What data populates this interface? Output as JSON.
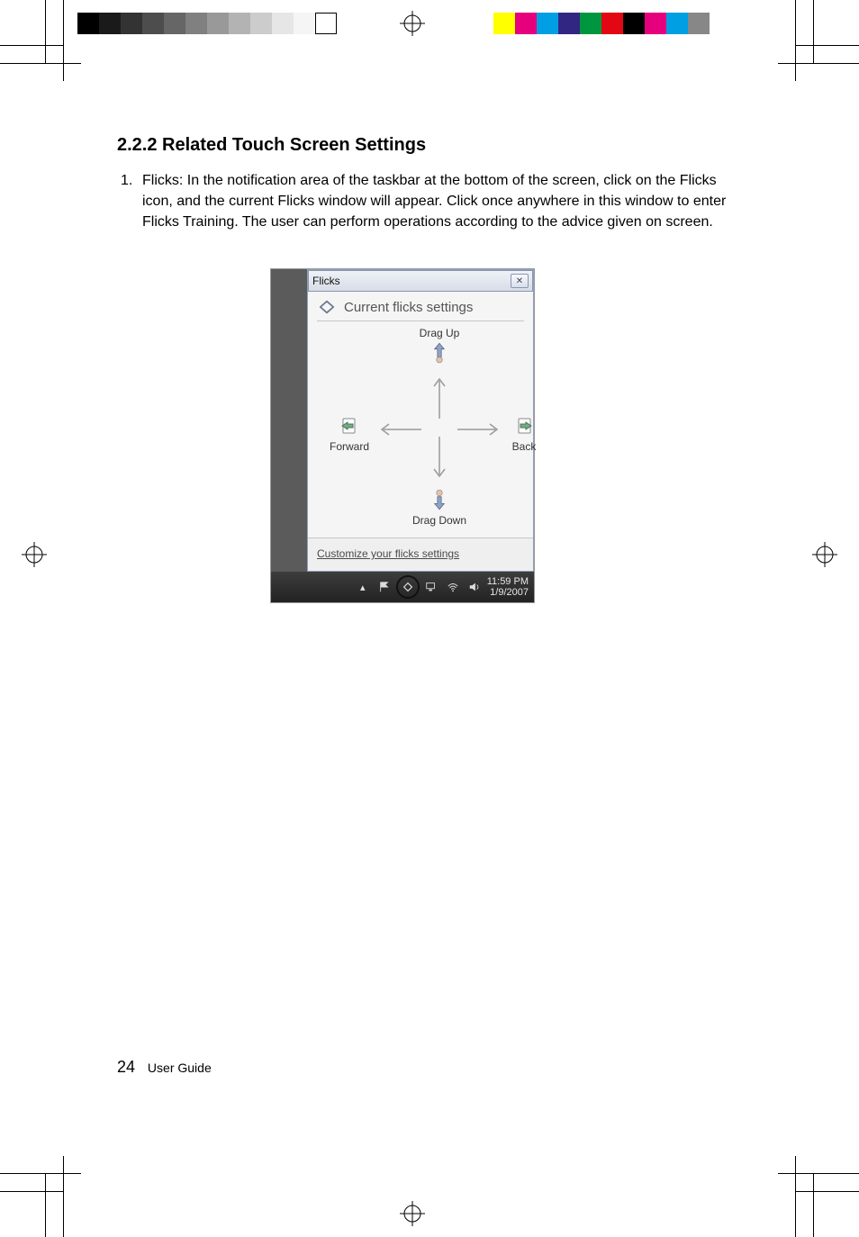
{
  "section": {
    "number": "2.2.2",
    "title": "Related Touch Screen Settings"
  },
  "list": {
    "item1_number": "1.",
    "item1_text": "Flicks: In the notification area of the taskbar at the bottom of the screen, click on the Flicks icon, and the current Flicks window will appear. Click once anywhere in this window to enter Flicks Training. The user can perform operations according to the advice given on screen."
  },
  "screenshot": {
    "window_title": "Flicks",
    "heading": "Current flicks settings",
    "directions": {
      "up": "Drag Up",
      "down": "Drag Down",
      "left": "Forward",
      "right": "Back"
    },
    "customize_link": "Customize your flicks settings",
    "clock": {
      "time": "11:59 PM",
      "date": "1/9/2007"
    }
  },
  "footer": {
    "page_number": "24",
    "label": "User Guide"
  }
}
